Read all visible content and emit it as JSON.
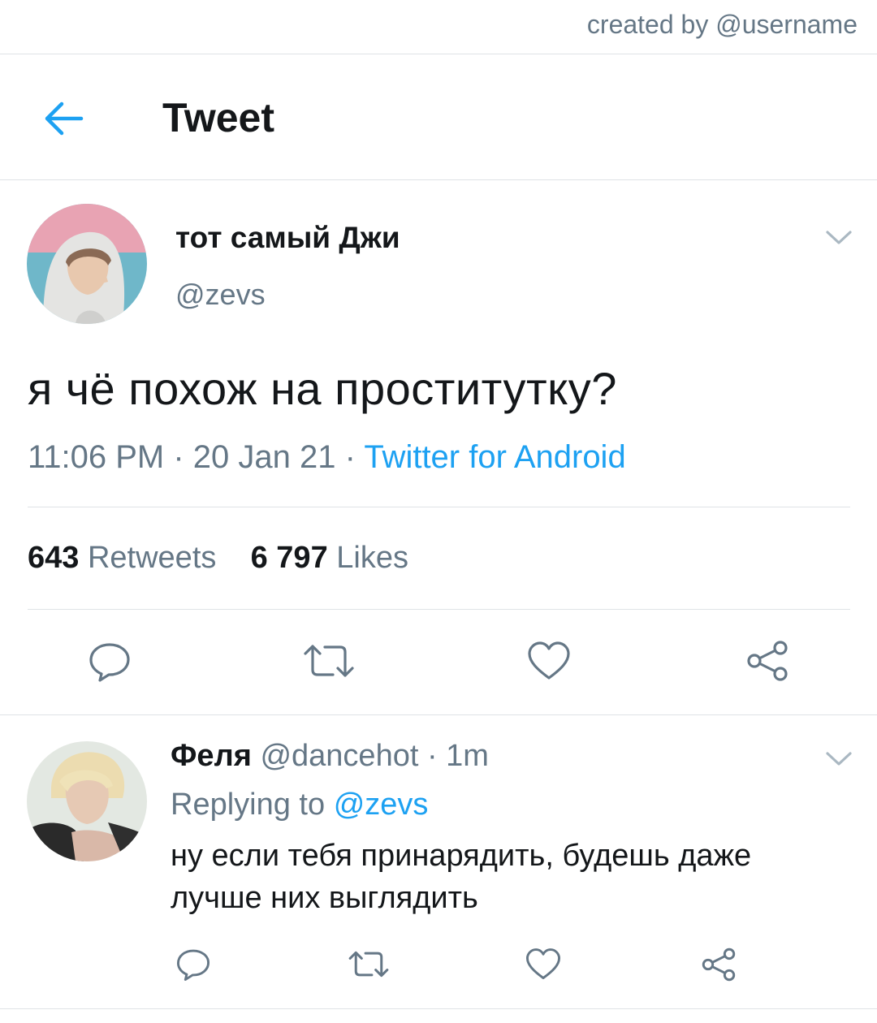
{
  "credit": "created by @username",
  "header": {
    "title": "Tweet",
    "back_icon": "arrow-left-icon",
    "accent": "#1da1f2"
  },
  "tweet": {
    "display_name": "тот самый Джи",
    "handle": "@zevs",
    "text": "я чё похож на проститутку?",
    "time": "11:06 PM",
    "sep1": " · ",
    "date": "20 Jan 21",
    "sep2": " · ",
    "source": "Twitter for Android",
    "retweets_count": "643",
    "retweets_label": "Retweets",
    "likes_count": "6 797",
    "likes_label": "Likes",
    "actions": [
      "reply-icon",
      "retweet-icon",
      "like-icon",
      "share-icon"
    ]
  },
  "reply": {
    "display_name": "Феля",
    "handle": "@dancehot",
    "sep": " · ",
    "time": "1m",
    "replying_label": "Replying to",
    "replying_to": "@zevs",
    "text": "ну если тебя принарядить, будешь даже лучше них выглядить",
    "actions": [
      "reply-icon",
      "retweet-icon",
      "like-icon",
      "share-icon"
    ]
  }
}
